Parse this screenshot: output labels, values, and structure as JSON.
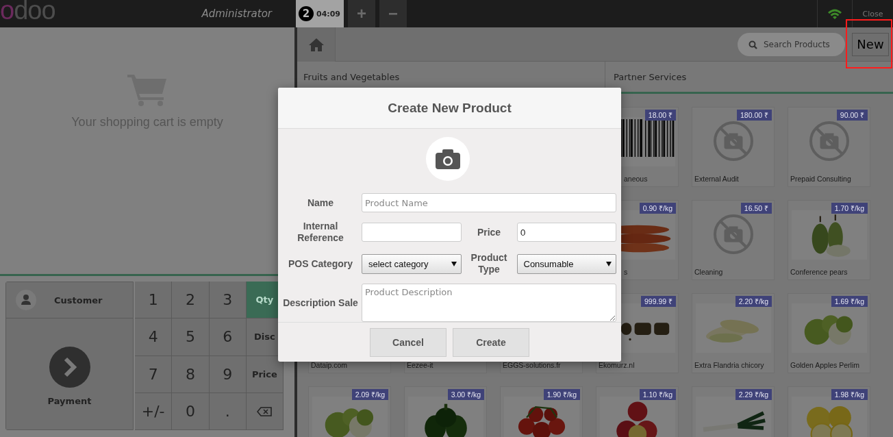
{
  "top_bar": {
    "logo": "odoo",
    "user": "Administrator",
    "order_tabs": [
      {
        "number": "2",
        "time": "04:09",
        "selected": true
      }
    ],
    "add_order": "+",
    "remove_order": "−",
    "close": "Close"
  },
  "cart": {
    "empty_message": "Your shopping cart is empty"
  },
  "actionpad": {
    "customer": "Customer",
    "payment": "Payment"
  },
  "numpad": {
    "rows": [
      [
        "1",
        "2",
        "3"
      ],
      [
        "4",
        "5",
        "6"
      ],
      [
        "7",
        "8",
        "9"
      ],
      [
        "+/-",
        "0",
        "."
      ]
    ],
    "modes": [
      {
        "label": "Qty",
        "selected": true
      },
      {
        "label": "Disc",
        "selected": false
      },
      {
        "label": "Price",
        "selected": false
      }
    ]
  },
  "toolbar": {
    "search": {
      "placeholder": "Search Products"
    },
    "new_button": "New",
    "highlighted": true
  },
  "categories": [
    "Fruits and Vegetables",
    "Partner Services"
  ],
  "product_rows": [
    [
      {
        "name": "aneous",
        "price": "18.00 ₹",
        "kind": "picture"
      },
      {
        "name": "External Audit",
        "price": "180.00 ₹",
        "kind": "placeholder"
      },
      {
        "name": "Prepaid Consulting",
        "price": "90.00 ₹",
        "kind": "placeholder"
      }
    ],
    [
      {
        "name": "s",
        "price": "0.90 ₹/kg",
        "kind": "picture"
      },
      {
        "name": "Cleaning",
        "price": "16.50 ₹",
        "kind": "placeholder"
      },
      {
        "name": "Conference pears",
        "price": "1.70 ₹/kg",
        "kind": "picture"
      }
    ],
    [
      {
        "name": "Dataip.com"
      },
      {
        "name": "Eezee-it"
      },
      {
        "name": "EGGS-solutions.fr"
      },
      {
        "name": "Ekomurz.nl",
        "price": "999.99 ₹",
        "kind": "picture"
      },
      {
        "name": "Extra Flandria chicory",
        "price": "2.20 ₹/kg",
        "kind": "picture"
      },
      {
        "name": "Golden Apples Perlim",
        "price": "1.69 ₹/kg",
        "kind": "picture"
      }
    ],
    [
      {
        "price": "2.09 ₹/kg",
        "kind": "picture"
      },
      {
        "price": "3.00 ₹/kg",
        "kind": "picture"
      },
      {
        "price": "1.90 ₹/kg",
        "kind": "picture"
      },
      {
        "price": "1.10 ₹/kg",
        "kind": "picture"
      },
      {
        "price": "2.29 ₹/kg",
        "kind": "picture"
      },
      {
        "price": "1.98 ₹/kg",
        "kind": "picture"
      }
    ]
  ],
  "dialog": {
    "title": "Create New Product",
    "rows": [
      [
        {
          "label": "Name",
          "kind": "text",
          "placeholder": "Product Name"
        }
      ],
      [
        {
          "label": "Internal Reference",
          "kind": "text"
        },
        {
          "label": "Price",
          "kind": "text",
          "value": "0"
        }
      ],
      [
        {
          "label": "POS Category",
          "kind": "select",
          "value": "select category"
        },
        {
          "label": "Product Type",
          "kind": "select",
          "value": "Consumable"
        }
      ],
      [
        {
          "label": "Description Sale",
          "kind": "textarea",
          "placeholder": "Product Description"
        }
      ]
    ],
    "buttons": [
      "Cancel",
      "Create"
    ]
  }
}
